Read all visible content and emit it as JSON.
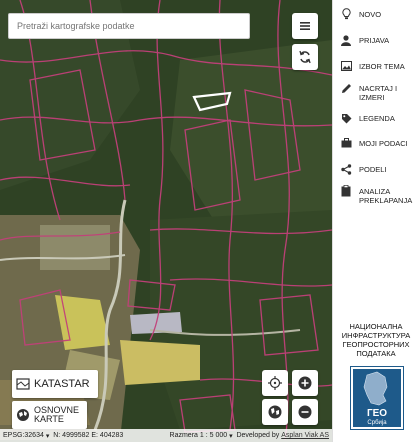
{
  "search": {
    "placeholder": "Pretraži kartografske podatke"
  },
  "map_buttons": {
    "menu_icon": "hamburger-icon",
    "refresh_icon": "refresh-icon"
  },
  "layers": {
    "cadastre": "KATASTAR",
    "base_maps_line1": "OSNOVNE",
    "base_maps_line2": "KARTE"
  },
  "status": {
    "epsg": "EPSG:32634",
    "coords": "N: 4999582 E: 404283",
    "scale": "Razmera 1 : 5 000",
    "developed_by": "Developed by",
    "developer": "Asplan Viak AS"
  },
  "menu": [
    {
      "label": "NOVO",
      "icon": "lightbulb-icon"
    },
    {
      "label": "PRIJAVA",
      "icon": "user-icon"
    },
    {
      "label": "IZBOR TEMA",
      "icon": "image-icon"
    },
    {
      "label": "NACRTAJ I IZMERI",
      "icon": "pencil-icon"
    },
    {
      "label": "LEGENDA",
      "icon": "tag-icon"
    },
    {
      "label": "MOJI PODACI",
      "icon": "briefcase-icon"
    },
    {
      "label": "PODELI",
      "icon": "share-icon"
    },
    {
      "label": "ANALIZA PREKLAPANJA",
      "icon": "clipboard-icon"
    }
  ],
  "branding": {
    "title": "НАЦИОНАЛНА ИНФРАСТРУКТУРА ГЕОПРОСТОРНИХ ПОДАТАКА",
    "logo_text": "ГЕО",
    "logo_subtext": "Србија"
  },
  "colors": {
    "parcel_line": "#c2407a",
    "highlight": "#ffffff",
    "logo_blue": "#1e5a8a"
  }
}
